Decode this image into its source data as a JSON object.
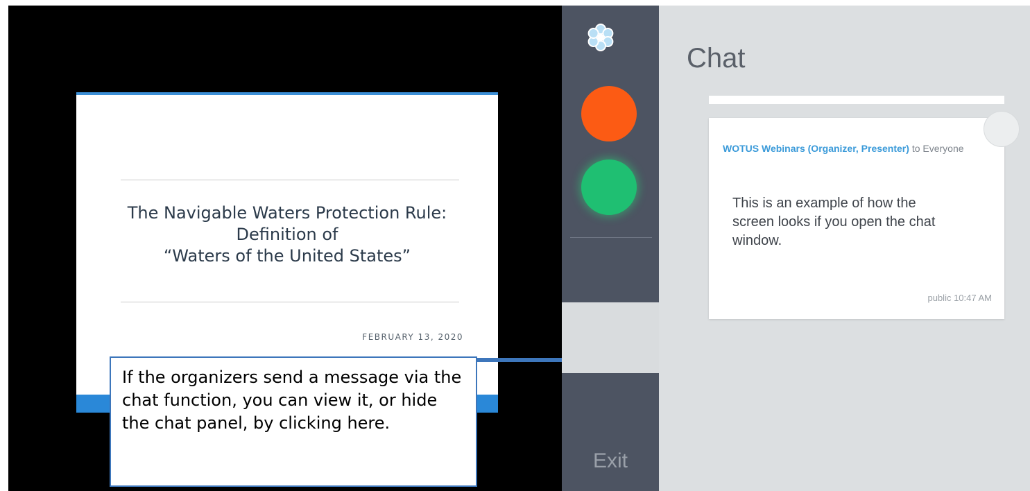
{
  "slide": {
    "title": "The Navigable Waters Protection Rule:\nDefinition of\n“Waters of the United States”",
    "date": "FEBRUARY 13, 2020"
  },
  "callout": {
    "text": "If the organizers send a message via the chat function, you can view it, or hide the chat panel, by clicking here."
  },
  "sidebar": {
    "logo_icon": "flower-logo-icon",
    "buttons": [
      {
        "name": "orange-circle-button",
        "color": "#fc5b14"
      },
      {
        "name": "green-circle-button",
        "color": "#1fbf72"
      }
    ],
    "exit_label": "Exit"
  },
  "chat": {
    "title": "Chat",
    "message": {
      "sender": "WOTUS Webinars (Organizer, Presenter)",
      "recipient": "to Everyone",
      "text": "This is an example of how the screen looks if you open the chat window.",
      "meta": "public 10:47 AM"
    }
  },
  "colors": {
    "accent_blue": "#2a88d8",
    "sidebar_dark": "#4d5462",
    "chat_bg": "#dcdfe1",
    "link_blue": "#3a9ad9"
  }
}
